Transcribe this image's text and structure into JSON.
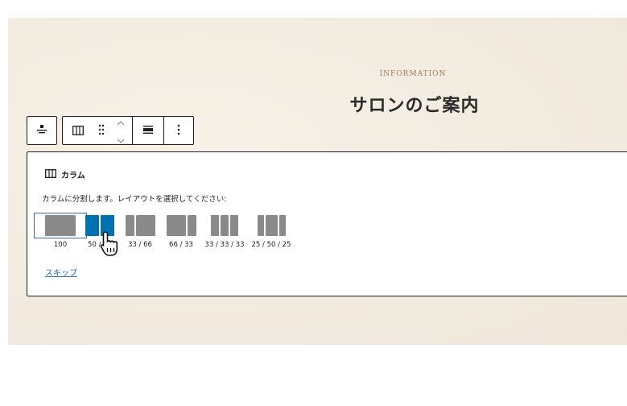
{
  "page": {
    "eyebrow": "INFORMATION",
    "heading": "サロンのご案内"
  },
  "toolbar": {
    "icons": [
      "align-icon",
      "columns-icon",
      "drag-handle-icon",
      "move-up-icon",
      "move-down-icon",
      "full-width-icon",
      "more-options-icon"
    ]
  },
  "placeholder": {
    "title": "カラム",
    "instructions": "カラムに分割します。レイアウトを選択してください:",
    "options": [
      {
        "label": "100"
      },
      {
        "label": "50 / 50"
      },
      {
        "label": "33 / 66"
      },
      {
        "label": "66 / 33"
      },
      {
        "label": "33 / 33 / 33"
      },
      {
        "label": "25 / 50 / 25"
      }
    ],
    "skip": "スキップ"
  },
  "colors": {
    "accent": "#0071b0",
    "link": "#2271b1",
    "eyebrow": "#a27b57",
    "variation_icon": "#8a8a8a"
  }
}
